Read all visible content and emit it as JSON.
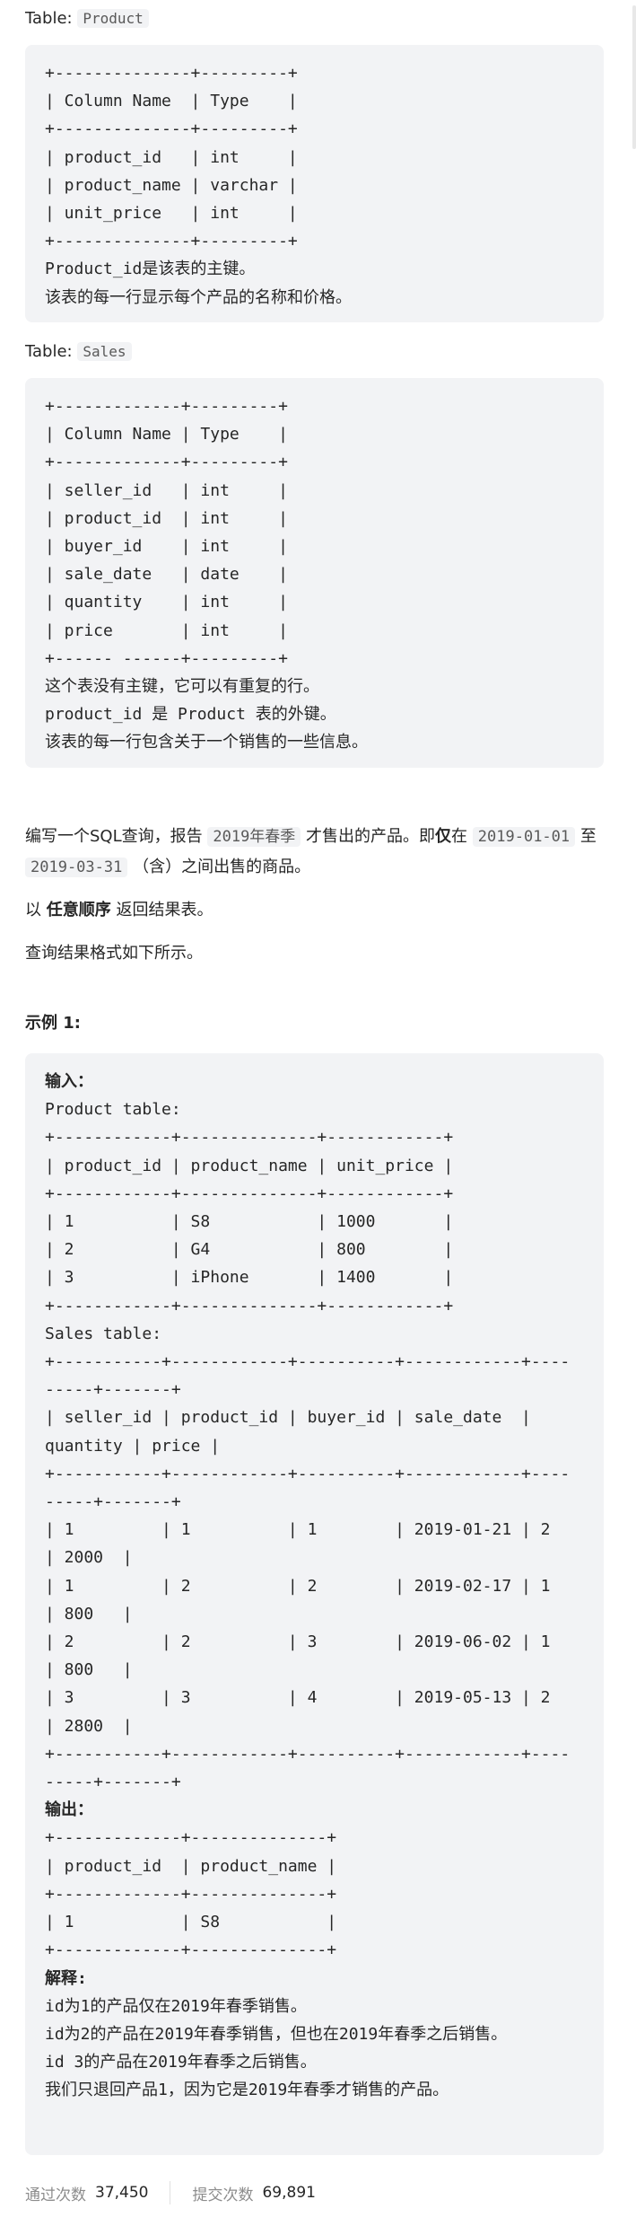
{
  "product_table": {
    "label": "Table:",
    "name": "Product",
    "schema_lines": [
      "+--------------+---------+",
      "| Column Name  | Type    |",
      "+--------------+---------+",
      "| product_id   | int     |",
      "| product_name | varchar |",
      "| unit_price   | int     |",
      "+--------------+---------+"
    ],
    "notes": [
      "Product_id是该表的主键。",
      "该表的每一行显示每个产品的名称和价格。"
    ]
  },
  "sales_table": {
    "label": "Table:",
    "name": "Sales",
    "schema_lines": [
      "+-------------+---------+",
      "| Column Name | Type    |",
      "+-------------+---------+",
      "| seller_id   | int     |",
      "| product_id  | int     |",
      "| buyer_id    | int     |",
      "| sale_date   | date    |",
      "| quantity    | int     |",
      "| price       | int     |",
      "+------ ------+---------+"
    ],
    "notes": [
      "这个表没有主键，它可以有重复的行。",
      "product_id 是 Product 表的外键。",
      "该表的每一行包含关于一个销售的一些信息。"
    ]
  },
  "description": {
    "p1_a": "编写一个SQL查询，报告",
    "p1_hl1": "2019年春季",
    "p1_b": "才售出的产品。即",
    "p1_bold": "仅",
    "p1_c": "在",
    "p1_hl2": "2019-01-01",
    "p1_d": "至",
    "p1_hl3": "2019-03-31",
    "p1_e": "（含）之间出售的商品。",
    "p2_a": "以",
    "p2_bold": "任意顺序",
    "p2_b": "返回结果表。",
    "p3": "查询结果格式如下所示。"
  },
  "example": {
    "heading": "示例 1:",
    "input_label": "输入：",
    "product_caption": "Product table:",
    "product_lines": [
      "+------------+--------------+------------+",
      "| product_id | product_name | unit_price |",
      "+------------+--------------+------------+",
      "| 1          | S8           | 1000       |",
      "| 2          | G4           | 800        |",
      "| 3          | iPhone       | 1400       |",
      "+------------+--------------+------------+"
    ],
    "sales_caption": "Sales table:",
    "sales_lines": [
      "+-----------+------------+----------+------------+----",
      "-----+-------+",
      "| seller_id | product_id | buyer_id | sale_date  |",
      "quantity | price |",
      "+-----------+------------+----------+------------+----",
      "-----+-------+",
      "| 1         | 1          | 1        | 2019-01-21 | 2",
      "| 2000  |",
      "| 1         | 2          | 2        | 2019-02-17 | 1",
      "| 800   |",
      "| 2         | 2          | 3        | 2019-06-02 | 1",
      "| 800   |",
      "| 3         | 3          | 4        | 2019-05-13 | 2",
      "| 2800  |",
      "+-----------+------------+----------+------------+----",
      "-----+-------+"
    ],
    "output_label": "输出：",
    "output_lines": [
      "+-------------+--------------+",
      "| product_id  | product_name |",
      "+-------------+--------------+",
      "| 1           | S8           |",
      "+-------------+--------------+"
    ],
    "explain_label": "解释:",
    "explain_lines": [
      "id为1的产品仅在2019年春季销售。",
      "id为2的产品在2019年春季销售，但也在2019年春季之后销售。",
      "id 3的产品在2019年春季之后销售。",
      "我们只退回产品1，因为它是2019年春季才销售的产品。"
    ]
  },
  "footer": {
    "accepted_label": "通过次数",
    "accepted_value": "37,450",
    "submitted_label": "提交次数",
    "submitted_value": "69,891"
  }
}
